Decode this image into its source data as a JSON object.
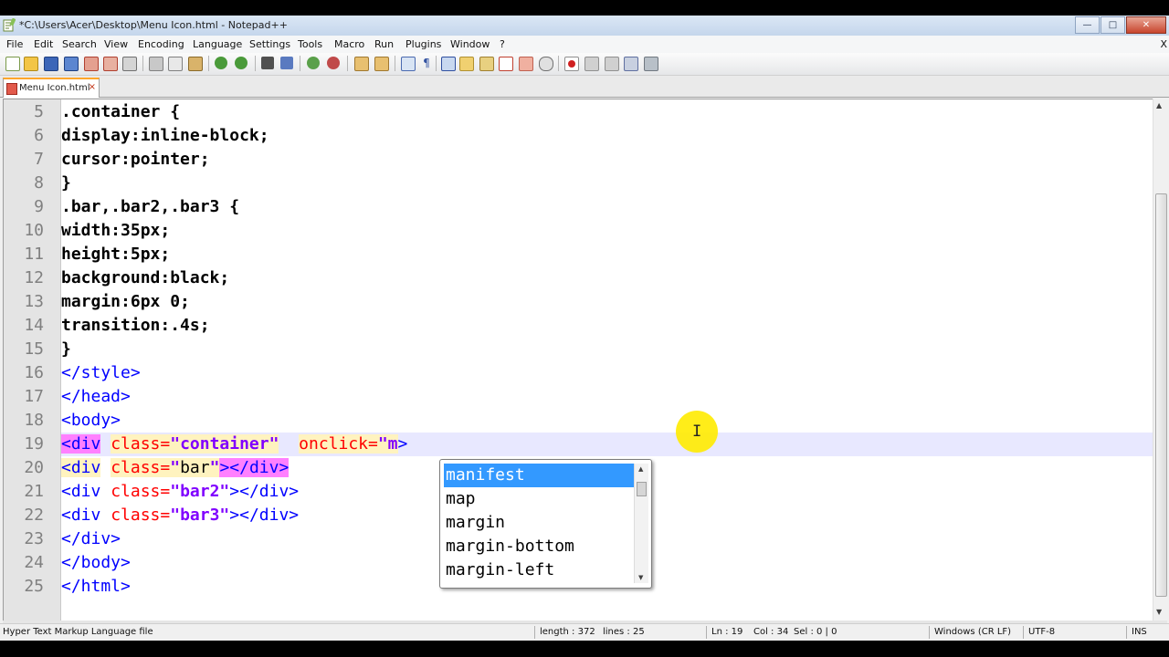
{
  "window": {
    "title": "*C:\\Users\\Acer\\Desktop\\Menu Icon.html - Notepad++"
  },
  "menu": [
    "File",
    "Edit",
    "Search",
    "View",
    "Encoding",
    "Language",
    "Settings",
    "Tools",
    "Macro",
    "Run",
    "Plugins",
    "Window",
    "?"
  ],
  "menu_close": "X",
  "tab": {
    "label": "Menu Icon.html",
    "close": "×"
  },
  "editor": {
    "line_numbers": [
      "5",
      "6",
      "7",
      "8",
      "9",
      "10",
      "11",
      "12",
      "13",
      "14",
      "15",
      "16",
      "17",
      "18",
      "19",
      "20",
      "21",
      "22",
      "23",
      "24",
      "25"
    ],
    "lines": {
      "l5": ".container {",
      "l6": "display:inline-block;",
      "l7": "cursor:pointer;",
      "l8": "}",
      "l9": ".bar,.bar2,.bar3 {",
      "l10": "width:35px;",
      "l11": "height:5px;",
      "l12": "background:black;",
      "l13": "margin:6px 0;",
      "l14": "transition:.4s;",
      "l15": "}",
      "l16": "</style>",
      "l17": "</head>",
      "l18": "<body>",
      "l19": {
        "t1": "<div",
        "sp1": " ",
        "a1": "class=",
        "v1": "\"container\"",
        "sp2": "  ",
        "a2": "onclick=",
        "v2": "\"m",
        "t2": ">"
      },
      "l20": {
        "t1": "<div",
        "sp1": " ",
        "a1": "class=",
        "v1": "\"",
        "v1b": "bar",
        "v1c": "\"",
        "t2": "></div>"
      },
      "l21": {
        "t1": "<div",
        "sp1": " ",
        "a1": "class=",
        "v1": "\"bar2\"",
        "t2": "></div>"
      },
      "l22": {
        "t1": "<div",
        "sp1": " ",
        "a1": "class=",
        "v1": "\"bar3\"",
        "t2": "></div>"
      },
      "l23": "</div>",
      "l24": "</body>",
      "l25": "</html>"
    }
  },
  "autocomplete": {
    "items": [
      "manifest",
      "map",
      "margin",
      "margin-bottom",
      "margin-left"
    ],
    "selected": "manifest"
  },
  "status": {
    "filetype": "Hyper Text Markup Language file",
    "length": "length : 372",
    "lines": "lines : 25",
    "ln": "Ln : 19",
    "col": "Col : 34",
    "sel": "Sel : 0 | 0",
    "eol": "Windows (CR LF)",
    "encoding": "UTF-8",
    "ins": "INS"
  },
  "colors": {
    "current_line": "#e8e8ff",
    "tag": "#0000ff",
    "attr": "#ff0000",
    "attr_value": "#8000ff",
    "selection": "#3399ff",
    "cursor_highlight": "#ffeb00"
  },
  "icons": [
    "notepadpp-app-icon",
    "new-file-icon",
    "open-file-icon",
    "save-icon",
    "save-all-icon",
    "close-icon",
    "close-all-icon",
    "print-icon",
    "cut-icon",
    "copy-icon",
    "paste-icon",
    "undo-icon",
    "redo-icon",
    "find-icon",
    "replace-icon",
    "zoom-in-icon",
    "zoom-out-icon",
    "sync-v-icon",
    "sync-h-icon",
    "word-wrap-icon",
    "show-all-chars-icon",
    "indent-guide-icon",
    "udl-icon",
    "doc-map-icon",
    "function-list-icon",
    "folder-workspace-icon",
    "monitoring-icon",
    "record-macro-icon",
    "stop-macro-icon",
    "play-macro-icon",
    "run-macro-multiple-icon",
    "save-macro-icon"
  ]
}
